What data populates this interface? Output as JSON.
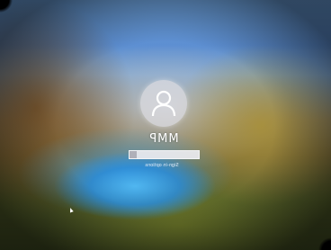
{
  "login": {
    "username": "MMP",
    "pin_placeholder": "",
    "sign_in_options": "Sign-in options"
  },
  "icons": {
    "avatar": "user-icon",
    "submit": "arrow-right-icon",
    "cursor": "mouse-cursor-icon"
  },
  "colors": {
    "avatar_bg": "#dcdce1",
    "field_bg": "#ebebf0",
    "lake_blue": "#50b9f5"
  }
}
